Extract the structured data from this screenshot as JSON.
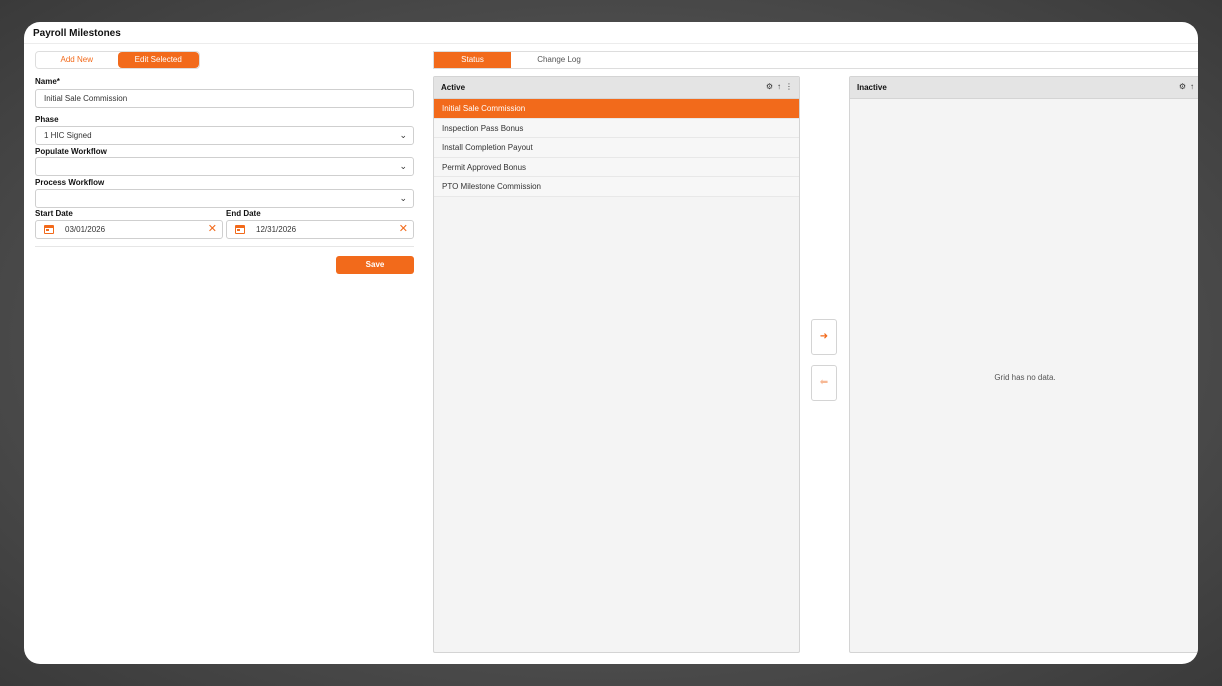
{
  "window": {
    "title": "Payroll Milestones"
  },
  "mode_toggle": {
    "add_new": "Add New",
    "edit_selected": "Edit Selected"
  },
  "form": {
    "name_label": "Name*",
    "name_value": "Initial Sale Commission",
    "phase_label": "Phase",
    "phase_value": "1 HIC Signed",
    "populate_label": "Populate Workflow",
    "populate_value": "",
    "process_label": "Process Workflow",
    "process_value": "",
    "start_label": "Start Date",
    "start_value": "03/01/2026",
    "end_label": "End Date",
    "end_value": "12/31/2026",
    "save": "Save"
  },
  "tabs": {
    "status": "Status",
    "change_log": "Change Log"
  },
  "active_grid": {
    "title": "Active",
    "rows": [
      "Initial Sale Commission",
      "Inspection Pass Bonus",
      "Install Completion Payout",
      "Permit Approved Bonus",
      "PTO Milestone Commission"
    ]
  },
  "inactive_grid": {
    "title": "Inactive",
    "empty_text": "Grid has no data."
  },
  "icons": {
    "settings": "gear-icon",
    "sort": "arrow-up-icon",
    "more": "kebab-icon",
    "move_right": "arrow-right-icon",
    "move_left": "arrow-left-icon",
    "calendar": "calendar-icon",
    "clear": "close-icon",
    "dropdown": "chevron-down-icon"
  },
  "colors": {
    "accent": "#f26a1b"
  }
}
